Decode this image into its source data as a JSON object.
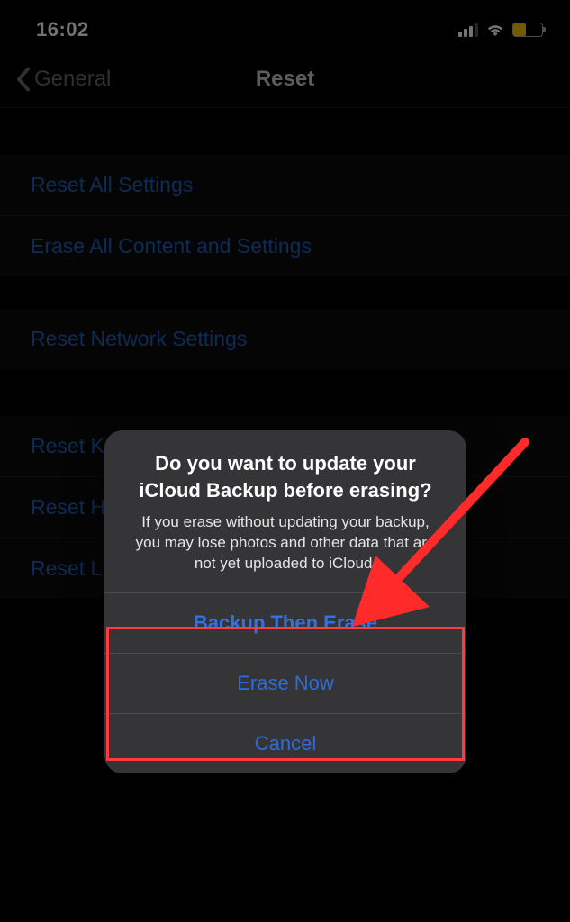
{
  "status_bar": {
    "time": "16:02"
  },
  "nav": {
    "back_label": "General",
    "title": "Reset"
  },
  "groups": {
    "g1": {
      "reset_all_settings": "Reset All Settings",
      "erase_all_content": "Erase All Content and Settings"
    },
    "g2": {
      "reset_network": "Reset Network Settings"
    },
    "g3": {
      "reset_keyboard_dictionary_truncated": "Reset K",
      "reset_home_screen_truncated": "Reset H",
      "reset_location_truncated": "Reset L"
    }
  },
  "alert": {
    "title": "Do you want to update your iCloud Backup before erasing?",
    "message": "If you erase without updating your backup, you may lose photos and other data that are not yet uploaded to iCloud.",
    "backup_then_erase": "Backup Then Erase",
    "erase_now": "Erase Now",
    "cancel": "Cancel"
  }
}
